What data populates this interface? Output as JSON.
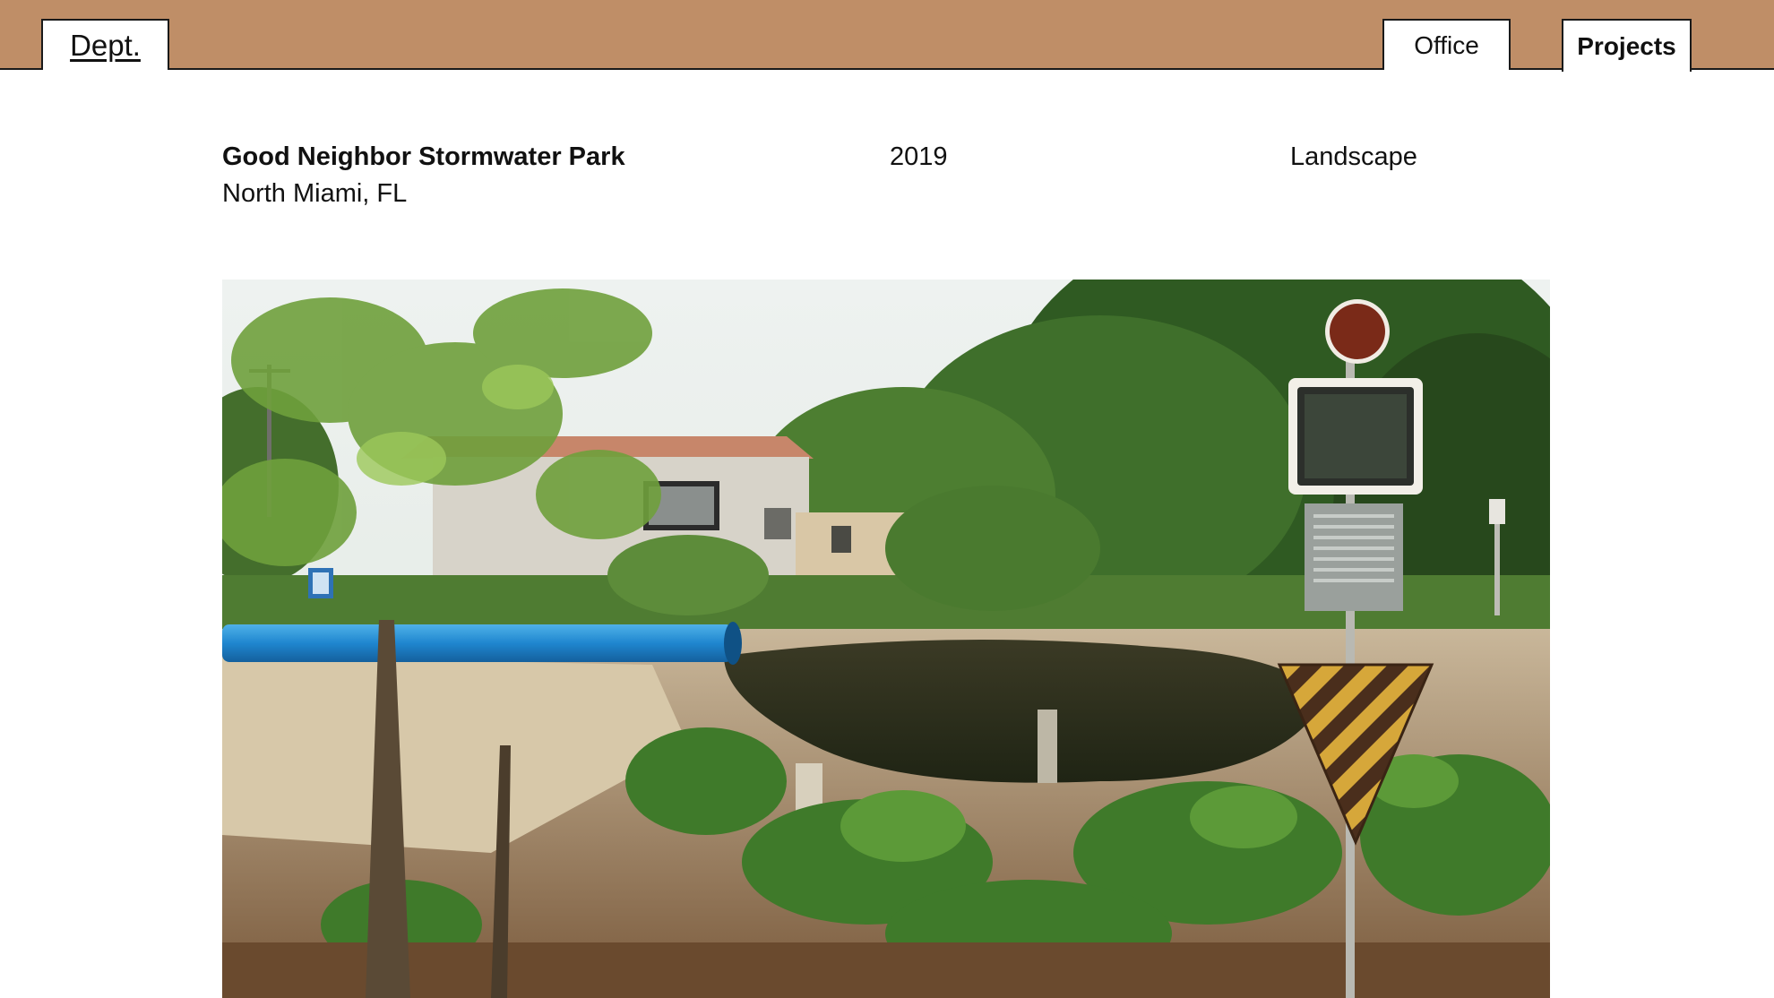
{
  "nav": {
    "logo": "Dept.",
    "tabs": [
      {
        "label": "Office",
        "active": false
      },
      {
        "label": "Projects",
        "active": true
      }
    ]
  },
  "project": {
    "title": "Good Neighbor Stormwater Park",
    "location": "North Miami, FL",
    "year": "2019",
    "category": "Landscape"
  },
  "colors": {
    "header_bg": "#bf8e67",
    "page_bg": "#ffffff"
  }
}
